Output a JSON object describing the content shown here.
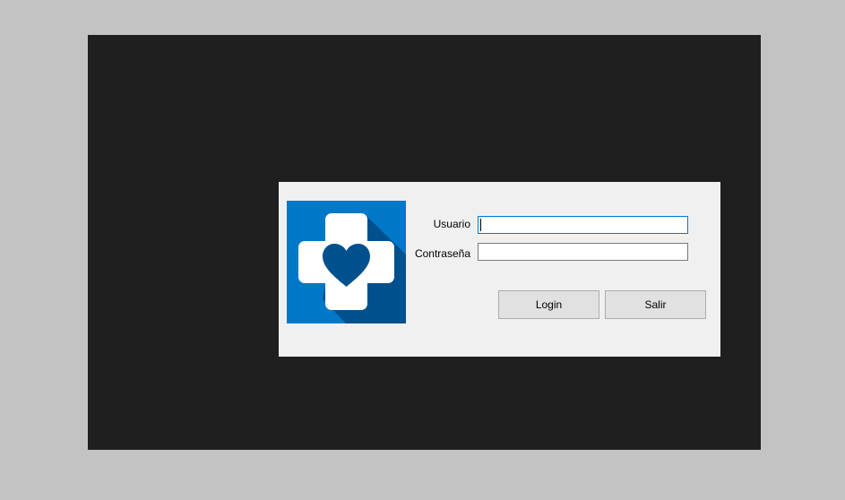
{
  "colors": {
    "screen_background": "#c3c3c3",
    "backdrop": "#1f1f1f",
    "dialog_background": "#f0f0f0",
    "logo_blue": "#0078c8",
    "logo_shadow": "#00508e",
    "logo_heart": "#00508e",
    "focus_border": "#0078d7",
    "button_face": "#e1e1e1"
  },
  "login_form": {
    "logo_icon": "medical-cross-heart-icon",
    "username_label": "Usuario",
    "username_value": "",
    "password_label": "Contraseña",
    "password_value": "",
    "login_button": "Login",
    "exit_button": "Salir"
  }
}
